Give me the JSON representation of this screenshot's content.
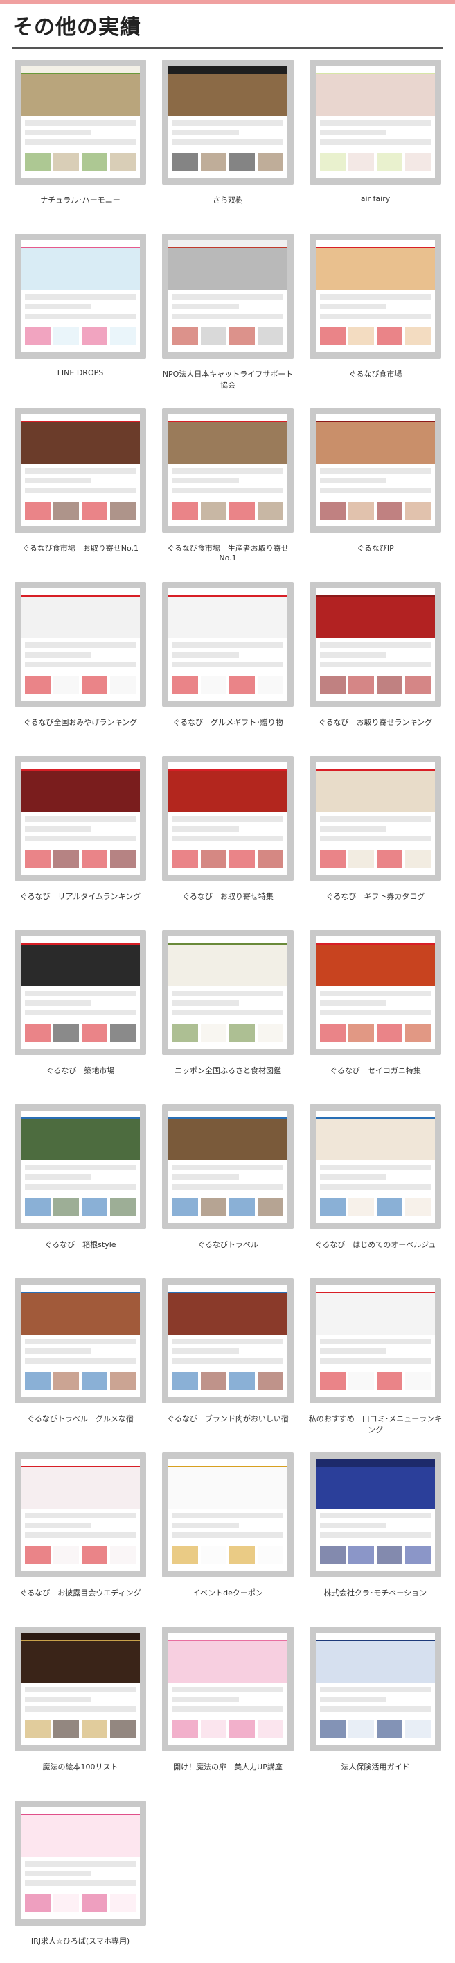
{
  "page": {
    "title": "その他の実績"
  },
  "works": [
    {
      "caption": "ナチュラル･ハーモニー",
      "thumb": {
        "head": "#f3f0e6",
        "accent": "#6a9a3a",
        "hero": "#b9a57c"
      }
    },
    {
      "caption": "さら双樹",
      "thumb": {
        "head": "#1f1f1f",
        "accent": "#1f1f1f",
        "hero": "#8b6a46"
      }
    },
    {
      "caption": "air fairy",
      "thumb": {
        "head": "#ffffff",
        "accent": "#d7e6a6",
        "hero": "#e9d6cf"
      }
    },
    {
      "caption": "LINE DROPS",
      "thumb": {
        "head": "#ffffff",
        "accent": "#e65a8c",
        "hero": "#d9ecf5"
      }
    },
    {
      "caption": "NPO法人日本キャットライフサポート協会",
      "thumb": {
        "head": "#f0f0f0",
        "accent": "#c0392b",
        "hero": "#b9b9b9"
      }
    },
    {
      "caption": "ぐるなび食市場",
      "thumb": {
        "head": "#ffffff",
        "accent": "#d81f26",
        "hero": "#e9c08e"
      }
    },
    {
      "caption": "ぐるなび食市場　お取り寄せNo.1",
      "thumb": {
        "head": "#ffffff",
        "accent": "#d81f26",
        "hero": "#6b3c2a"
      }
    },
    {
      "caption": "ぐるなび食市場　生産者お取り寄せNo.1",
      "thumb": {
        "head": "#ffffff",
        "accent": "#d81f26",
        "hero": "#9a7b5a"
      }
    },
    {
      "caption": "ぐるなびIP",
      "thumb": {
        "head": "#ffffff",
        "accent": "#8c1a1a",
        "hero": "#c98f6a"
      }
    },
    {
      "caption": "ぐるなび全国おみやげランキング",
      "thumb": {
        "head": "#ffffff",
        "accent": "#d81f26",
        "hero": "#f2f2f2"
      }
    },
    {
      "caption": "ぐるなび　グルメギフト･贈り物",
      "thumb": {
        "head": "#ffffff",
        "accent": "#d81f26",
        "hero": "#f4f4f4"
      }
    },
    {
      "caption": "ぐるなび　お取り寄せランキング",
      "thumb": {
        "head": "#ffffff",
        "accent": "#8c1a1a",
        "hero": "#b22222"
      }
    },
    {
      "caption": "ぐるなび　リアルタイムランキング",
      "thumb": {
        "head": "#ffffff",
        "accent": "#d81f26",
        "hero": "#7a1d1d"
      }
    },
    {
      "caption": "ぐるなび　お取り寄せ特集",
      "thumb": {
        "head": "#ffffff",
        "accent": "#d81f26",
        "hero": "#b3261e"
      }
    },
    {
      "caption": "ぐるなび　ギフト券カタログ",
      "thumb": {
        "head": "#ffffff",
        "accent": "#d81f26",
        "hero": "#e8dcc9"
      }
    },
    {
      "caption": "ぐるなび　築地市場",
      "thumb": {
        "head": "#ffffff",
        "accent": "#d81f26",
        "hero": "#2a2a2a"
      }
    },
    {
      "caption": "ニッポン全国ふるさと食材図鑑",
      "thumb": {
        "head": "#ffffff",
        "accent": "#6a8a3a",
        "hero": "#f2efe6"
      }
    },
    {
      "caption": "ぐるなび　セイコガニ特集",
      "thumb": {
        "head": "#ffffff",
        "accent": "#d81f26",
        "hero": "#c8431f"
      }
    },
    {
      "caption": "ぐるなび　箱根style",
      "thumb": {
        "head": "#ffffff",
        "accent": "#2a6fb5",
        "hero": "#4d6c3f"
      }
    },
    {
      "caption": "ぐるなびトラベル",
      "thumb": {
        "head": "#ffffff",
        "accent": "#2a6fb5",
        "hero": "#7a5a3a"
      }
    },
    {
      "caption": "ぐるなび　はじめてのオーベルジュ",
      "thumb": {
        "head": "#ffffff",
        "accent": "#2a6fb5",
        "hero": "#f0e6d8"
      }
    },
    {
      "caption": "ぐるなびトラベル　グルメな宿",
      "thumb": {
        "head": "#ffffff",
        "accent": "#2a6fb5",
        "hero": "#a15a3a"
      }
    },
    {
      "caption": "ぐるなび　ブランド肉がおいしい宿",
      "thumb": {
        "head": "#ffffff",
        "accent": "#2a6fb5",
        "hero": "#8a3a2a"
      }
    },
    {
      "caption": "私のおすすめ　口コミ･メニューランキング",
      "thumb": {
        "head": "#ffffff",
        "accent": "#d81f26",
        "hero": "#f4f4f4"
      }
    },
    {
      "caption": "ぐるなび　お披露目会ウエディング",
      "thumb": {
        "head": "#ffffff",
        "accent": "#d81f26",
        "hero": "#f6eef0"
      }
    },
    {
      "caption": "イベントdeクーポン",
      "thumb": {
        "head": "#ffffff",
        "accent": "#d8a020",
        "hero": "#fafafa"
      }
    },
    {
      "caption": "株式会社クラ･モチベーション",
      "thumb": {
        "head": "#1d2a6b",
        "accent": "#1d2a6b",
        "hero": "#2b3f9a"
      }
    },
    {
      "caption": "魔法の絵本100リスト",
      "thumb": {
        "head": "#2b1a12",
        "accent": "#c9a24a",
        "hero": "#3a2418"
      }
    },
    {
      "caption": "開け！魔法の扉　美人力UP講座",
      "thumb": {
        "head": "#ffffff",
        "accent": "#e86fa0",
        "hero": "#f7cfe0"
      }
    },
    {
      "caption": "法人保険活用ガイド",
      "thumb": {
        "head": "#ffffff",
        "accent": "#1d3a7a",
        "hero": "#d6e0ef"
      }
    },
    {
      "caption": "IRJ求人☆ひろば(スマホ専用)",
      "thumb": {
        "head": "#ffffff",
        "accent": "#e0508a",
        "hero": "#fde6ef"
      }
    }
  ]
}
